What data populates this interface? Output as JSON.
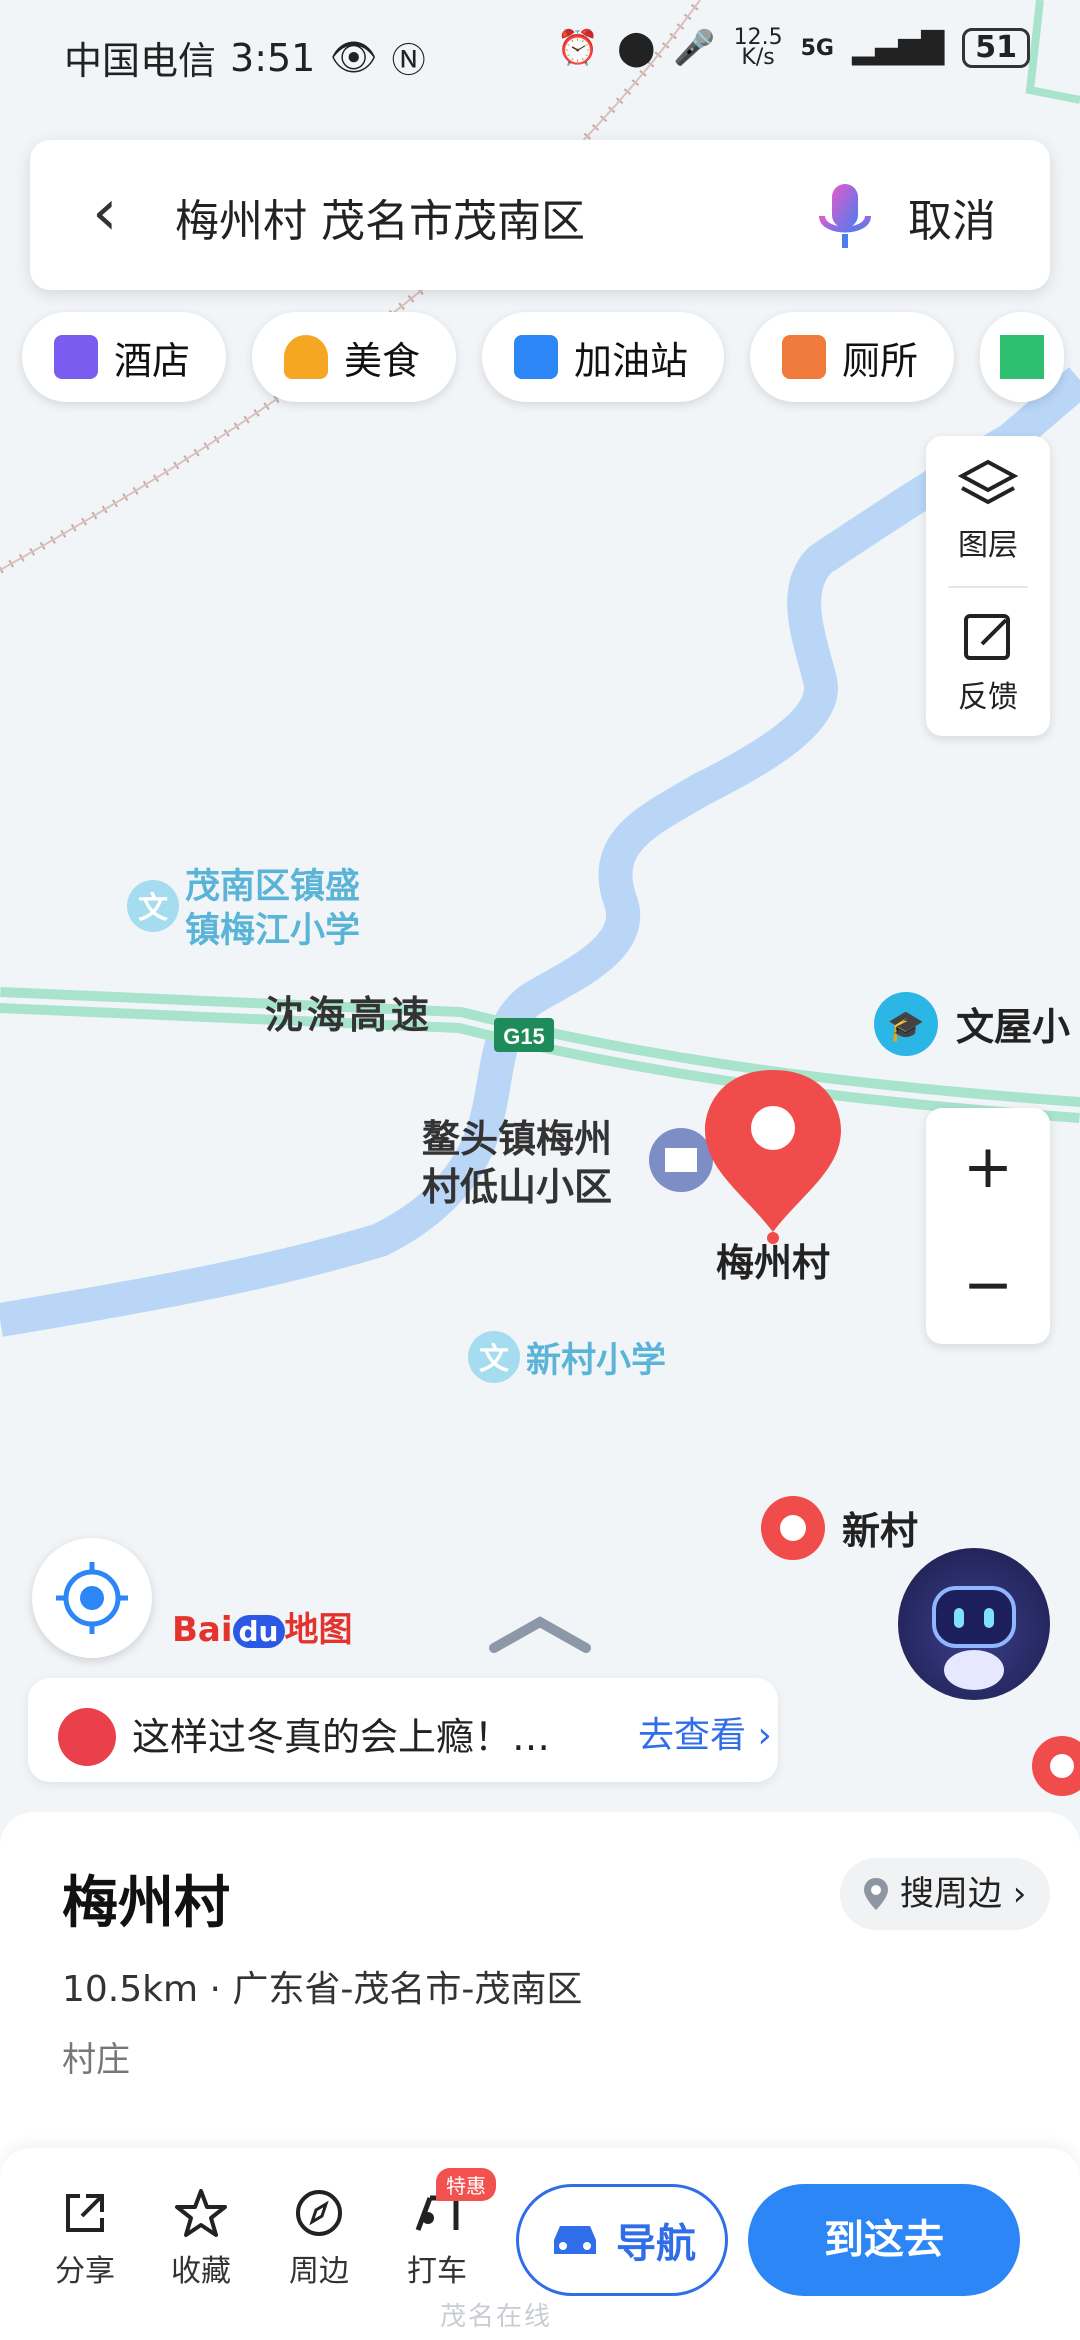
{
  "status_bar": {
    "carrier": "中国电信",
    "time": "3:51",
    "network_speed": "12.5",
    "network_speed_unit": "K/s",
    "signal": "5G",
    "battery": "51"
  },
  "search": {
    "query": "梅州村 茂名市茂南区",
    "cancel_label": "取消"
  },
  "categories": [
    {
      "label": "酒店",
      "icon": "hotel-icon",
      "color": "#7a5cf0"
    },
    {
      "label": "美食",
      "icon": "food-icon",
      "color": "#f5a623"
    },
    {
      "label": "加油站",
      "icon": "gas-station-icon",
      "color": "#2d86f5"
    },
    {
      "label": "厕所",
      "icon": "toilet-icon",
      "color": "#f07a3c"
    }
  ],
  "side_tools": {
    "layers_label": "图层",
    "feedback_label": "反馈"
  },
  "zoom": {
    "in_label": "+",
    "out_label": "−"
  },
  "map": {
    "highway_name": "沈海高速",
    "highway_code": "G15",
    "poi_school_1": [
      "茂南区镇盛",
      "镇梅江小学"
    ],
    "poi_school_2": "文屋小",
    "poi_residential": [
      "鳌头镇梅州",
      "村低山小区"
    ],
    "poi_village": "梅州村",
    "poi_school_3": "新村小学",
    "poi_village_2": "新村",
    "colors": {
      "water": "#b9d6f7",
      "road": "#a8e3cc",
      "railway": "#c9a9a2",
      "pin": "#f04c4c"
    }
  },
  "brand": {
    "logo_left": "Bai",
    "logo_mid": "du",
    "logo_right": "地图"
  },
  "banner": {
    "text": "这样过冬真的会上瘾！…",
    "action": "去查看 ›"
  },
  "place": {
    "name": "梅州村",
    "search_nearby": "搜周边 ›",
    "distance": "10.5km",
    "address": "广东省-茂名市-茂南区",
    "type": "村庄"
  },
  "actions": {
    "share": "分享",
    "favorite": "收藏",
    "nearby": "周边",
    "taxi": "打车",
    "taxi_badge": "特惠",
    "navigate": "导航",
    "go_here": "到这去"
  },
  "watermark": "茂名在线"
}
